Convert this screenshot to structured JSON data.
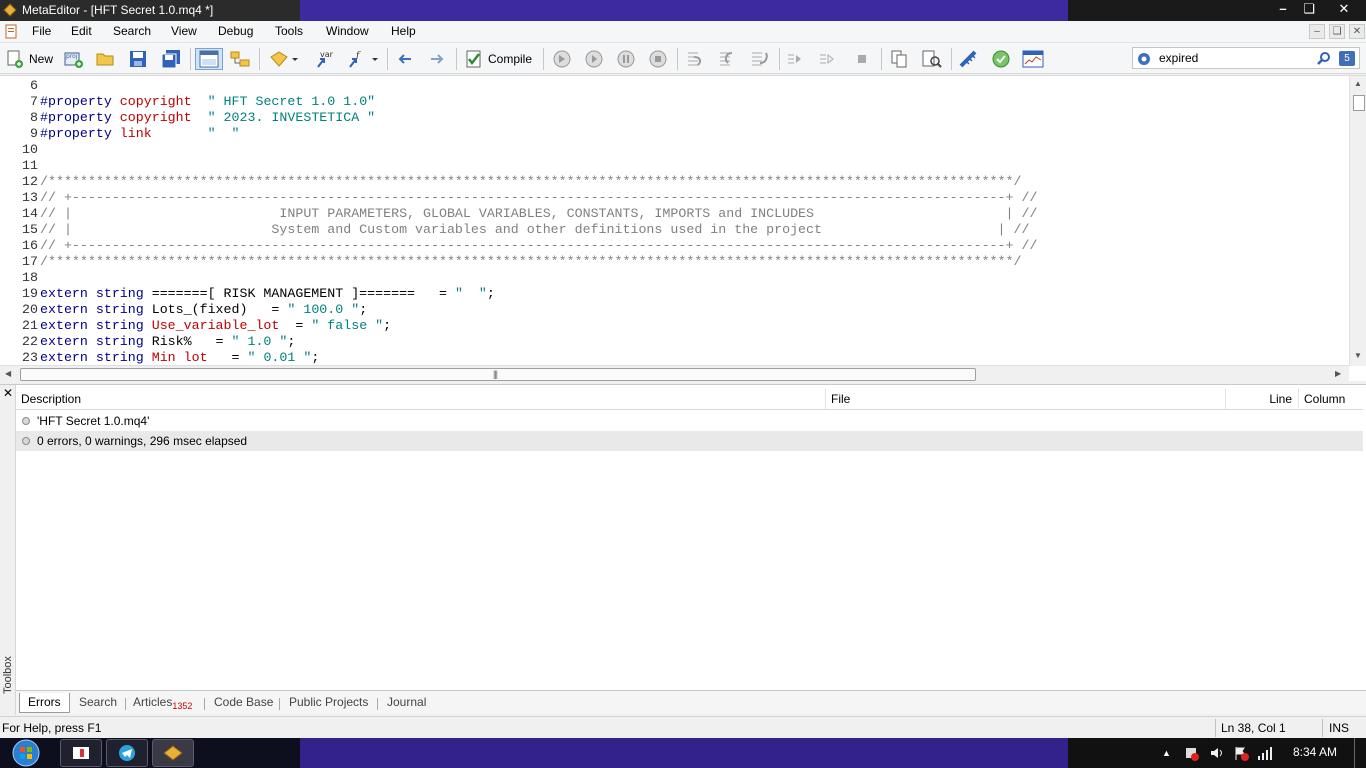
{
  "window": {
    "title": "MetaEditor - [HFT Secret 1.0.mq4 *]"
  },
  "menu": {
    "items": [
      "File",
      "Edit",
      "Search",
      "View",
      "Debug",
      "Tools",
      "Window",
      "Help"
    ]
  },
  "toolbar": {
    "new_label": "New",
    "compile_label": "Compile",
    "var_label": "var",
    "proj_label": "proj",
    "search_value": "expired",
    "search_count": "5"
  },
  "editor": {
    "lines": [
      {
        "n": "6",
        "parts": []
      },
      {
        "n": "7",
        "parts": [
          {
            "c": "kw",
            "t": "#property "
          },
          {
            "c": "rd",
            "t": "copyright"
          },
          {
            "c": "",
            "t": "  "
          },
          {
            "c": "st",
            "t": "\" HFT Secret 1.0 1.0\""
          }
        ]
      },
      {
        "n": "8",
        "parts": [
          {
            "c": "kw",
            "t": "#property "
          },
          {
            "c": "rd",
            "t": "copyright"
          },
          {
            "c": "",
            "t": "  "
          },
          {
            "c": "st",
            "t": "\" 2023. INVESTETICA \""
          }
        ]
      },
      {
        "n": "9",
        "parts": [
          {
            "c": "kw",
            "t": "#property "
          },
          {
            "c": "rd",
            "t": "link"
          },
          {
            "c": "",
            "t": "       "
          },
          {
            "c": "st",
            "t": "\"  \""
          }
        ]
      },
      {
        "n": "10",
        "parts": []
      },
      {
        "n": "11",
        "parts": []
      },
      {
        "n": "12",
        "parts": [
          {
            "c": "cm",
            "t": "/*************************************************************************************************************************/"
          }
        ]
      },
      {
        "n": "13",
        "parts": [
          {
            "c": "cm",
            "t": "// +---------------------------------------------------------------------------------------------------------------------+ //"
          }
        ]
      },
      {
        "n": "14",
        "parts": [
          {
            "c": "cm",
            "t": "// |                          INPUT PARAMETERS, GLOBAL VARIABLES, CONSTANTS, IMPORTS and INCLUDES                        | //"
          }
        ]
      },
      {
        "n": "15",
        "parts": [
          {
            "c": "cm",
            "t": "// |                         System and Custom variables and other definitions used in the project                      | //"
          }
        ]
      },
      {
        "n": "16",
        "parts": [
          {
            "c": "cm",
            "t": "// +---------------------------------------------------------------------------------------------------------------------+ //"
          }
        ]
      },
      {
        "n": "17",
        "parts": [
          {
            "c": "cm",
            "t": "/*************************************************************************************************************************/"
          }
        ]
      },
      {
        "n": "18",
        "parts": []
      },
      {
        "n": "19",
        "parts": [
          {
            "c": "kw",
            "t": "extern string "
          },
          {
            "c": "",
            "t": "=======[ RISK MANAGEMENT ]=======   = "
          },
          {
            "c": "st",
            "t": "\"  \""
          },
          {
            "c": "",
            "t": ";"
          }
        ]
      },
      {
        "n": "20",
        "parts": [
          {
            "c": "kw",
            "t": "extern string "
          },
          {
            "c": "",
            "t": "Lots_(fixed)   = "
          },
          {
            "c": "st",
            "t": "\" 100.0 \""
          },
          {
            "c": "",
            "t": ";"
          }
        ]
      },
      {
        "n": "21",
        "parts": [
          {
            "c": "kw",
            "t": "extern string "
          },
          {
            "c": "rd",
            "t": "Use_variable_lot"
          },
          {
            "c": "",
            "t": "  = "
          },
          {
            "c": "st",
            "t": "\" false \""
          },
          {
            "c": "",
            "t": ";"
          }
        ]
      },
      {
        "n": "22",
        "parts": [
          {
            "c": "kw",
            "t": "extern string "
          },
          {
            "c": "",
            "t": "Risk%   = "
          },
          {
            "c": "st",
            "t": "\" 1.0 \""
          },
          {
            "c": "",
            "t": ";"
          }
        ]
      },
      {
        "n": "23",
        "parts": [
          {
            "c": "kw",
            "t": "extern string "
          },
          {
            "c": "rd",
            "t": "Min lot"
          },
          {
            "c": "",
            "t": "   = "
          },
          {
            "c": "st",
            "t": "\" 0.01 \""
          },
          {
            "c": "",
            "t": ";"
          }
        ]
      }
    ]
  },
  "toolbox": {
    "side_label": "Toolbox",
    "columns": {
      "description": "Description",
      "file": "File",
      "line": "Line",
      "column": "Column"
    },
    "rows": [
      {
        "description": "'HFT Secret 1.0.mq4'",
        "file": "",
        "line": "",
        "column": ""
      },
      {
        "description": "0 errors, 0 warnings, 296 msec elapsed",
        "file": "",
        "line": "",
        "column": ""
      }
    ],
    "tabs": [
      {
        "label": "Errors",
        "badge": ""
      },
      {
        "label": "Search",
        "badge": ""
      },
      {
        "label": "Articles",
        "badge": "1352"
      },
      {
        "label": "Code Base",
        "badge": ""
      },
      {
        "label": "Public Projects",
        "badge": ""
      },
      {
        "label": "Journal",
        "badge": ""
      }
    ]
  },
  "status": {
    "help": "For Help, press F1",
    "position": "Ln 38, Col 1",
    "mode": "INS"
  },
  "taskbar": {
    "clock": "8:34 AM"
  },
  "colors": {
    "keyword": "#00008b",
    "property": "#c00000",
    "string": "#008080",
    "comment": "#808080"
  }
}
